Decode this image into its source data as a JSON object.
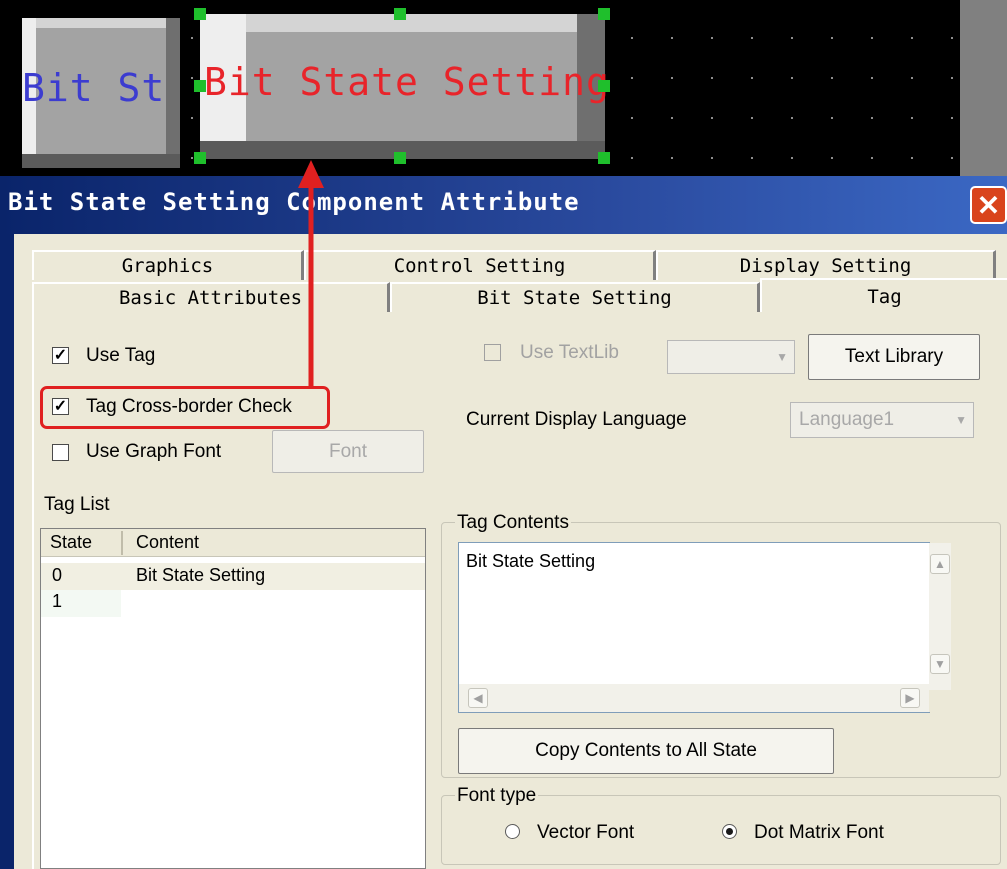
{
  "canvas": {
    "left_button_label": "Bit St",
    "selected_button_label": "Bit State Setting"
  },
  "dialog": {
    "title": "Bit State Setting Component Attribute",
    "close_glyph": "✕"
  },
  "tabs": {
    "back_row": [
      "Graphics",
      "Control Setting",
      "Display Setting"
    ],
    "front_row": [
      "Basic Attributes",
      "Bit State Setting",
      "Tag"
    ],
    "active": "Tag"
  },
  "options": {
    "use_tag": {
      "label": "Use Tag",
      "checked": true
    },
    "cross_border": {
      "label": "Tag Cross-border Check",
      "checked": true
    },
    "graph_font": {
      "label": "Use Graph Font",
      "checked": false
    },
    "font_button": "Font",
    "use_textlib": {
      "label": "Use TextLib",
      "checked": false
    },
    "text_library_button": "Text Library",
    "current_language_label": "Current Display Language",
    "current_language_value": "Language1"
  },
  "tag_list": {
    "title": "Tag List",
    "columns": [
      "State",
      "Content"
    ],
    "rows": [
      {
        "state": "0",
        "content": "Bit State Setting"
      },
      {
        "state": "1",
        "content": ""
      }
    ]
  },
  "tag_contents": {
    "title": "Tag Contents",
    "text": "Bit State Setting",
    "copy_button": "Copy Contents to All State"
  },
  "font_type": {
    "title": "Font type",
    "options": [
      "Vector Font",
      "Dot Matrix Font"
    ],
    "selected": "Dot Matrix Font"
  },
  "colors": {
    "selected_label": "#e8242a",
    "left_label": "#3c3cd0",
    "handle": "#1fbf2c",
    "highlight": "#e02020",
    "title_bar": "#0a246a"
  }
}
